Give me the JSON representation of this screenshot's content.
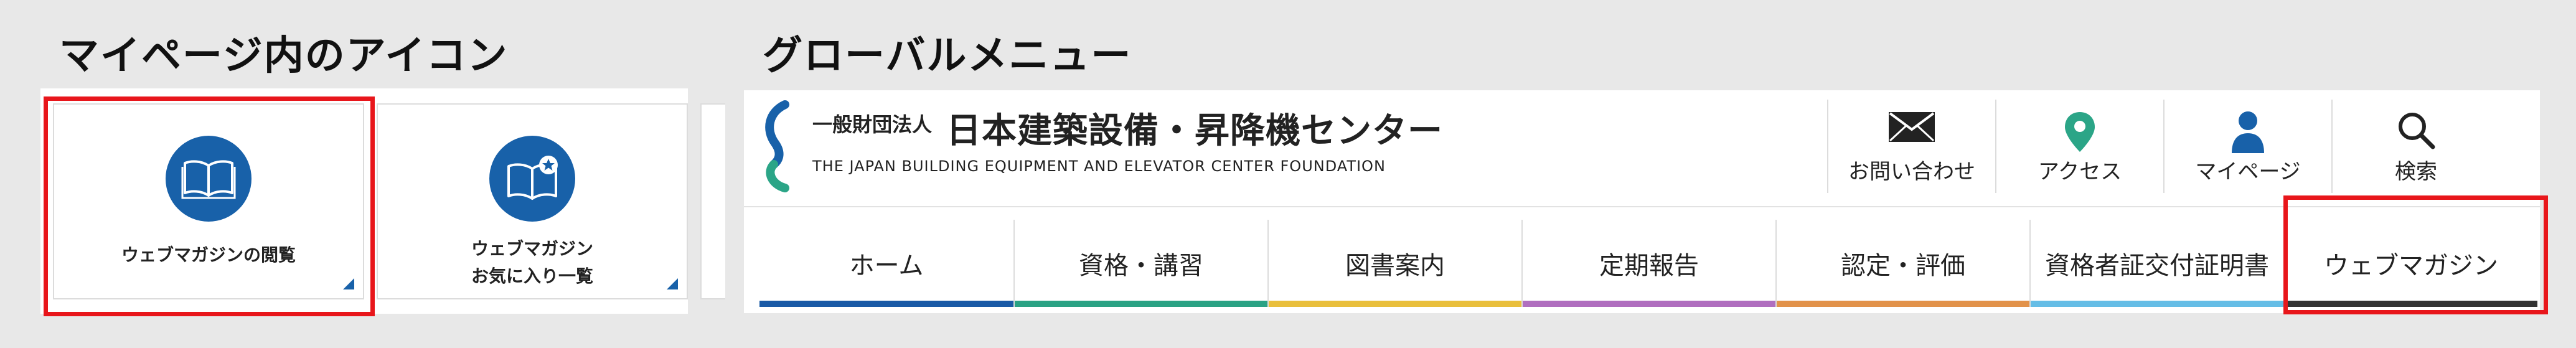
{
  "headings": {
    "mypage_icons": "マイページ内のアイコン",
    "global_menu": "グローバルメニュー"
  },
  "mypage": {
    "cards": [
      {
        "label": "ウェブマガジンの閲覧",
        "icon": "book-icon"
      },
      {
        "label_line1": "ウェブマガジン",
        "label_line2": "お気に入り一覧",
        "icon": "book-star-icon"
      }
    ],
    "icon_color": "#1861a9"
  },
  "header": {
    "org_prefix": "一般財団法人",
    "org_name": "日本建築設備・昇降機センター",
    "org_name_en": "THE JAPAN BUILDING EQUIPMENT AND ELEVATOR CENTER FOUNDATION",
    "utility": [
      {
        "label": "お問い合わせ",
        "icon": "mail-icon"
      },
      {
        "label": "アクセス",
        "icon": "map-pin-icon"
      },
      {
        "label": "マイページ",
        "icon": "user-icon"
      },
      {
        "label": "検索",
        "icon": "search-icon"
      }
    ]
  },
  "global_nav": {
    "items": [
      {
        "label": "ホーム",
        "color": "#1a5aa6"
      },
      {
        "label": "資格・講習",
        "color": "#2aa284"
      },
      {
        "label": "図書案内",
        "color": "#e9bf3c"
      },
      {
        "label": "定期報告",
        "color": "#b06ebf"
      },
      {
        "label": "認定・評価",
        "color": "#e2924a"
      },
      {
        "label": "資格者証交付証明書",
        "color": "#65bde6"
      },
      {
        "label": "ウェブマガジン",
        "color": "#333333"
      }
    ]
  },
  "colors": {
    "highlight": "#e8161b",
    "pin": "#2ba587",
    "user": "#1861a9"
  }
}
